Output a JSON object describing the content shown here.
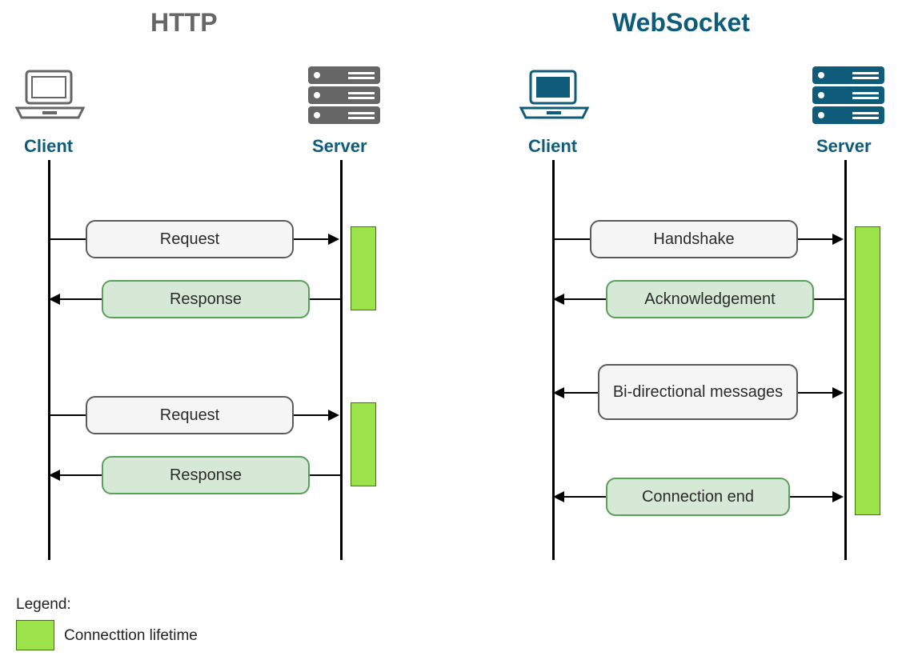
{
  "titles": {
    "http": "HTTP",
    "websocket": "WebSocket"
  },
  "actors": {
    "http_client": "Client",
    "http_server": "Server",
    "ws_client": "Client",
    "ws_server": "Server"
  },
  "messages": {
    "request": "Request",
    "response": "Response",
    "handshake": "Handshake",
    "acknowledgement": "Acknowledgement",
    "bidi": "Bi-directional messages",
    "conn_end": "Connection end"
  },
  "legend": {
    "heading": "Legend:",
    "lifetime": "Connecttion lifetime"
  },
  "colors": {
    "title_grey": "#666666",
    "title_teal": "#0e5b7a",
    "box_grey_bg": "#f5f5f5",
    "box_grey_border": "#5a5a5a",
    "box_green_bg": "#d6e9d6",
    "box_green_border": "#5aa05a",
    "lifetime_bg": "#9be24b",
    "lifetime_border": "#3a7a00"
  },
  "chart_data": {
    "type": "sequence-diagram",
    "panels": [
      {
        "name": "HTTP",
        "actors": [
          "Client",
          "Server"
        ],
        "events": [
          {
            "label": "Request",
            "from": "Client",
            "to": "Server",
            "style": "grey"
          },
          {
            "label": "Response",
            "from": "Server",
            "to": "Client",
            "style": "green"
          },
          {
            "label": "Request",
            "from": "Client",
            "to": "Server",
            "style": "grey"
          },
          {
            "label": "Response",
            "from": "Server",
            "to": "Client",
            "style": "green"
          }
        ],
        "connection_lifetime": [
          {
            "on": "Server",
            "span_events": [
              0,
              1
            ]
          },
          {
            "on": "Server",
            "span_events": [
              2,
              3
            ]
          }
        ]
      },
      {
        "name": "WebSocket",
        "actors": [
          "Client",
          "Server"
        ],
        "events": [
          {
            "label": "Handshake",
            "from": "Client",
            "to": "Server",
            "style": "grey"
          },
          {
            "label": "Acknowledgement",
            "from": "Server",
            "to": "Client",
            "style": "green"
          },
          {
            "label": "Bi-directional messages",
            "from": "both",
            "to": "both",
            "style": "grey"
          },
          {
            "label": "Connection end",
            "from": "both",
            "to": "both",
            "style": "green"
          }
        ],
        "connection_lifetime": [
          {
            "on": "Server",
            "span_events": [
              0,
              3
            ]
          }
        ]
      }
    ],
    "legend": [
      {
        "swatch": "lifetime",
        "label": "Connecttion lifetime"
      }
    ]
  }
}
